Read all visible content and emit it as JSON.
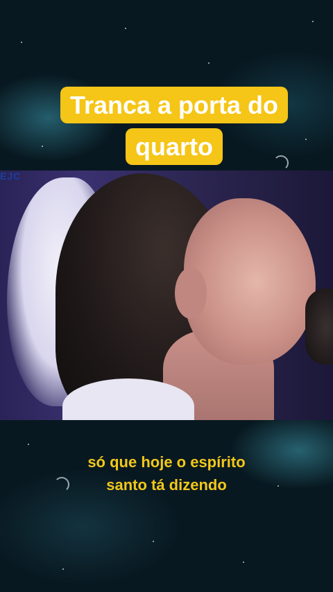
{
  "overlay": {
    "title": "Tranca a porta do quarto",
    "title_bg_color": "#f5c517",
    "title_text_color": "#ffffff"
  },
  "video": {
    "corner_text": "EJC"
  },
  "subtitle": {
    "line1": "só que hoje o espírito",
    "line2": "santo tá dizendo",
    "color": "#f2c81a"
  }
}
